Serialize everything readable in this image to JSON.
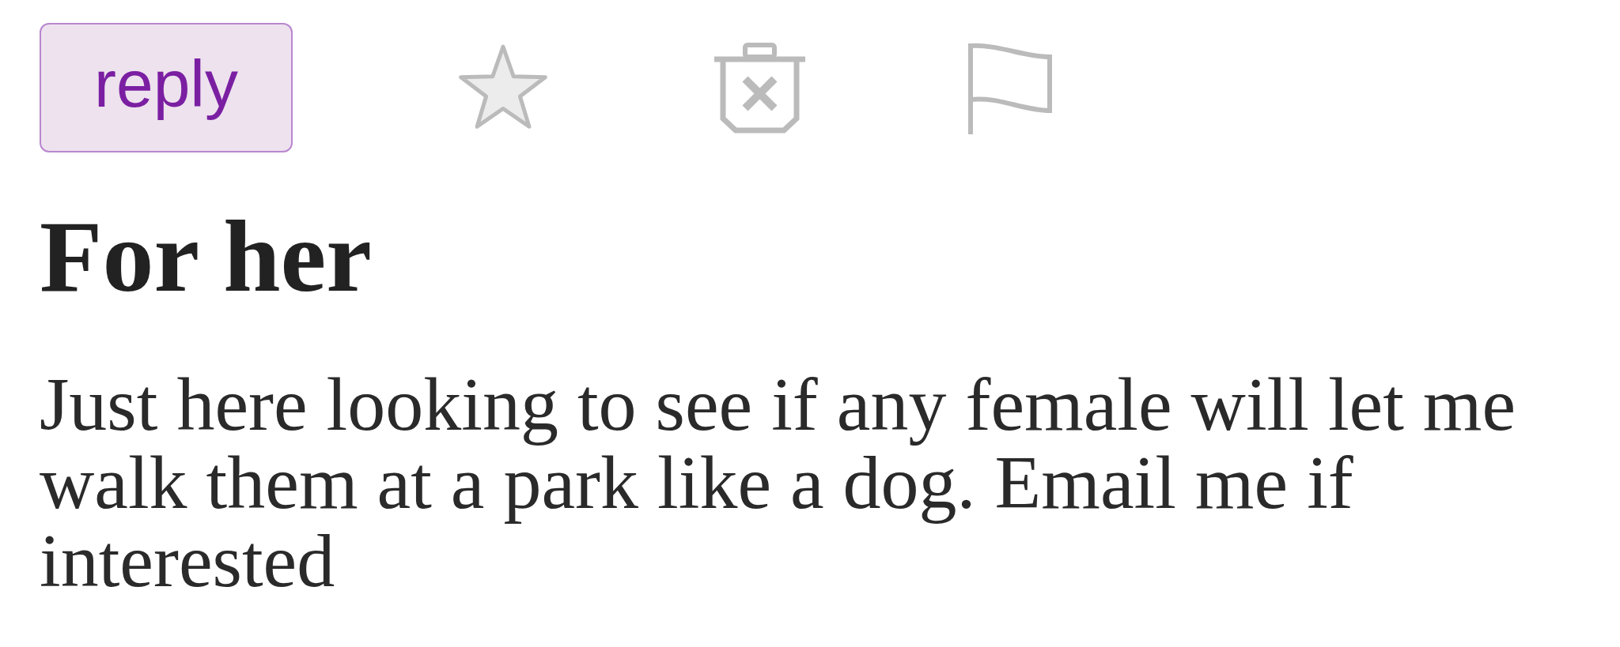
{
  "toolbar": {
    "reply_button": {
      "label": "reply"
    },
    "starred": false
  },
  "posting": {
    "title": "For her",
    "body": "Just here looking to see if any female will let me walk them at a park like a dog. Email me if interested"
  }
}
